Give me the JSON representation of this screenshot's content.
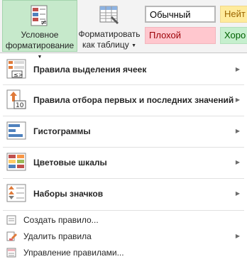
{
  "ribbon": {
    "conditional_formatting": {
      "line1": "Условное",
      "line2": "форматирование"
    },
    "format_as_table": {
      "line1": "Форматировать",
      "line2": "как таблицу"
    },
    "cell_styles": {
      "normal": "Обычный",
      "neutral": "Нейт",
      "bad": "Плохой",
      "good": "Хоро"
    }
  },
  "menu": {
    "items": [
      {
        "label": "Правила выделения ячеек",
        "icon": "highlight-cells-rules-icon"
      },
      {
        "label": "Правила отбора первых и последних значений",
        "icon": "top-bottom-rules-icon",
        "icon_text": "10"
      },
      {
        "label": "Гистограммы",
        "icon": "data-bars-icon"
      },
      {
        "label": "Цветовые шкалы",
        "icon": "color-scales-icon"
      },
      {
        "label": "Наборы значков",
        "icon": "icon-sets-icon"
      }
    ],
    "actions": [
      {
        "label": "Создать правило...",
        "icon": "new-rule-icon"
      },
      {
        "label": "Удалить правила",
        "icon": "clear-rules-icon"
      },
      {
        "label": "Управление правилами...",
        "icon": "manage-rules-icon"
      }
    ]
  },
  "colors": {
    "selected_button": "#c6e9cb",
    "ribbon_bg": "#f3f3f3"
  }
}
